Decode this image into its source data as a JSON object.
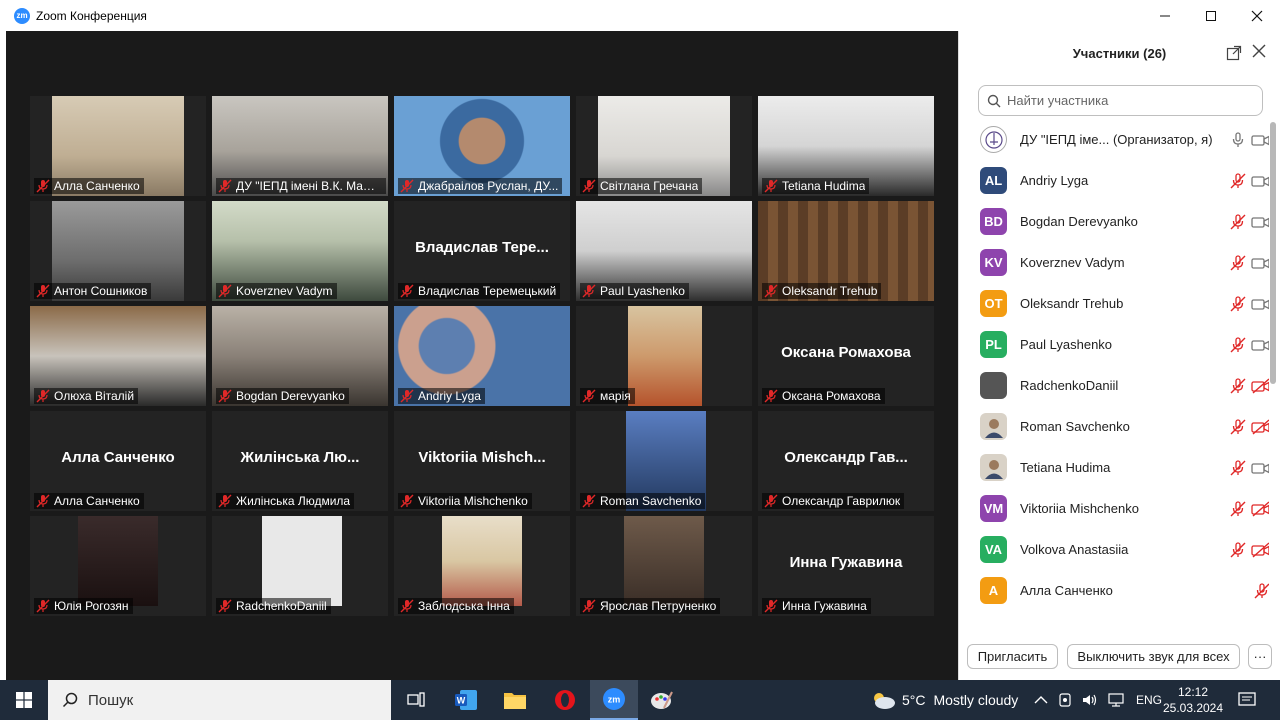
{
  "window": {
    "title": "Zoom Конференция",
    "logo_text": "zm"
  },
  "tiles": [
    {
      "name": "Алла Санченко",
      "has_video": true,
      "big_name": ""
    },
    {
      "name": "ДУ \"ІЕПД імені В.К. Мамут...",
      "has_video": true,
      "big_name": "",
      "active": true
    },
    {
      "name": "Джабраілов Руслан, ДУ...",
      "has_video": true,
      "big_name": ""
    },
    {
      "name": "Світлана Гречана",
      "has_video": true,
      "big_name": ""
    },
    {
      "name": "Tetiana Hudima",
      "has_video": true,
      "big_name": ""
    },
    {
      "name": "Антон Сошников",
      "has_video": true,
      "big_name": ""
    },
    {
      "name": "Koverznev Vadym",
      "has_video": true,
      "big_name": ""
    },
    {
      "name": "Владислав Теремецький",
      "has_video": false,
      "big_name": "Владислав Тере..."
    },
    {
      "name": "Paul Lyashenko",
      "has_video": true,
      "big_name": ""
    },
    {
      "name": "Oleksandr Trehub",
      "has_video": true,
      "big_name": ""
    },
    {
      "name": "Олюха Віталій",
      "has_video": true,
      "big_name": ""
    },
    {
      "name": "Bogdan Derevyanko",
      "has_video": true,
      "big_name": ""
    },
    {
      "name": "Andriy Lyga",
      "has_video": true,
      "big_name": ""
    },
    {
      "name": "марія",
      "has_video": true,
      "big_name": ""
    },
    {
      "name": "Оксана Ромахова",
      "has_video": false,
      "big_name": "Оксана Ромахова"
    },
    {
      "name": "Алла Санченко",
      "has_video": false,
      "big_name": "Алла Санченко"
    },
    {
      "name": "Жилінська Людмила",
      "has_video": false,
      "big_name": "Жилінська Лю..."
    },
    {
      "name": "Viktoriia Mishchenko",
      "has_video": false,
      "big_name": "Viktoriia Mishch..."
    },
    {
      "name": "Roman Savchenko",
      "has_video": true,
      "big_name": ""
    },
    {
      "name": "Олександр Гаврилюк",
      "has_video": false,
      "big_name": "Олександр Гав..."
    },
    {
      "name": "Юлія Рогозян",
      "has_video": true,
      "big_name": ""
    },
    {
      "name": "RadchenkoDaniil",
      "has_video": true,
      "big_name": ""
    },
    {
      "name": "Заблодська Інна",
      "has_video": true,
      "big_name": ""
    },
    {
      "name": "Ярослав Петруненко",
      "has_video": true,
      "big_name": ""
    },
    {
      "name": "Инна Гужавина",
      "has_video": false,
      "big_name": "Инна Гужавина"
    }
  ],
  "panel": {
    "title": "Участники (26)",
    "search_placeholder": "Найти участника",
    "participants": [
      {
        "initials": "",
        "name": "ДУ \"ІЕПД іме... (Организатор, я)",
        "color": "#ffffff",
        "photo": true,
        "mic": "on",
        "cam": "on"
      },
      {
        "initials": "AL",
        "name": "Andriy Lyga",
        "color": "#2f4b7a",
        "mic": "off",
        "cam": "on"
      },
      {
        "initials": "BD",
        "name": "Bogdan Derevyanko",
        "color": "#8e44ad",
        "mic": "off",
        "cam": "on"
      },
      {
        "initials": "KV",
        "name": "Koverznev Vadym",
        "color": "#8e44ad",
        "mic": "off",
        "cam": "on"
      },
      {
        "initials": "OT",
        "name": "Oleksandr Trehub",
        "color": "#f39c12",
        "mic": "off",
        "cam": "on"
      },
      {
        "initials": "PL",
        "name": "Paul Lyashenko",
        "color": "#27ae60",
        "mic": "off",
        "cam": "on"
      },
      {
        "initials": "",
        "name": "RadchenkoDaniil",
        "color": "#555555",
        "mic": "off",
        "cam": "off"
      },
      {
        "initials": "",
        "name": "Roman Savchenko",
        "color": "#d9d2c7",
        "photo": true,
        "mic": "off",
        "cam": "off"
      },
      {
        "initials": "",
        "name": "Tetiana Hudima",
        "color": "#d9d2c7",
        "photo": true,
        "mic": "off",
        "cam": "on"
      },
      {
        "initials": "VM",
        "name": "Viktoriia Mishchenko",
        "color": "#8e44ad",
        "mic": "off",
        "cam": "off"
      },
      {
        "initials": "VA",
        "name": "Volkova Anastasiia",
        "color": "#27ae60",
        "mic": "off",
        "cam": "off"
      },
      {
        "initials": "А",
        "name": "Алла Санченко",
        "color": "#f39c12",
        "mic": "off",
        "cam": "none"
      }
    ],
    "invite_label": "Пригласить",
    "mute_all_label": "Выключить звук для всех",
    "more_label": "···"
  },
  "taskbar": {
    "search_placeholder": "Пошук",
    "weather_temp": "5°C",
    "weather_text": "Mostly cloudy",
    "lang": "ENG",
    "time": "12:12",
    "date": "25.03.2024"
  },
  "colors": {
    "accent": "#2D8CFF",
    "active_speaker": "#b5d334",
    "mic_off": "#e02828",
    "taskbar": "#1f2b3a"
  }
}
